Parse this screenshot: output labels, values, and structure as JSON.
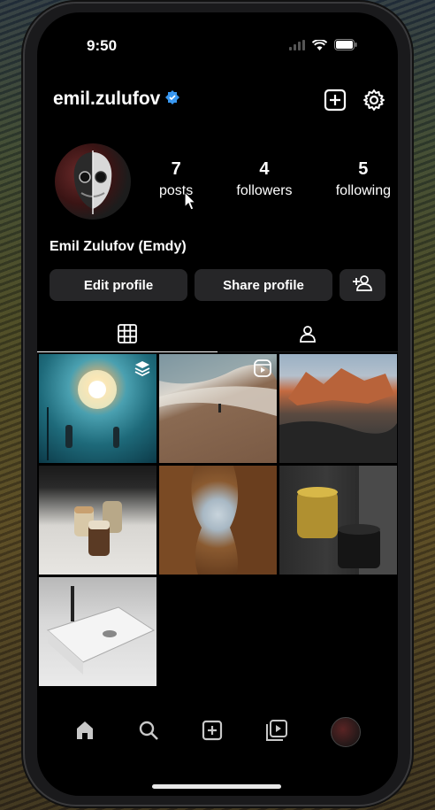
{
  "status_bar": {
    "time": "9:50"
  },
  "header": {
    "username": "emil.zulufov",
    "verified": true
  },
  "profile": {
    "full_name": "Emil Zulufov (Emdy)",
    "stats": [
      {
        "value": "7",
        "label": "posts"
      },
      {
        "value": "4",
        "label": "followers"
      },
      {
        "value": "5",
        "label": "following"
      }
    ]
  },
  "buttons": {
    "edit": "Edit profile",
    "share": "Share profile"
  },
  "tabs": [
    "grid-icon",
    "tagged-person-icon"
  ],
  "posts": [
    {
      "badge": "carousel-icon"
    },
    {
      "badge": "reel-icon"
    },
    {
      "badge": ""
    },
    {
      "badge": ""
    },
    {
      "badge": ""
    },
    {
      "badge": ""
    },
    {
      "badge": ""
    }
  ],
  "bottom_nav": [
    "home-icon",
    "search-icon",
    "create-icon",
    "reels-icon",
    "profile-avatar"
  ],
  "colors": {
    "background": "#000000",
    "button": "#262628",
    "verified": "#3897f0"
  }
}
